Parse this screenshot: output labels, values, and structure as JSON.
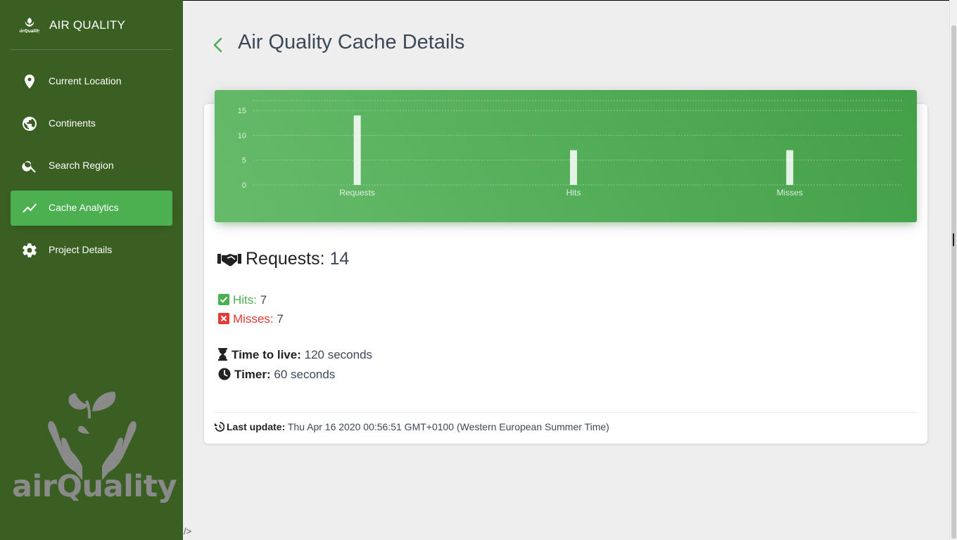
{
  "app": {
    "brand": "AIR QUALITY",
    "logo_text": "airQuality",
    "logo_small_text": "airQuality"
  },
  "nav": {
    "items": [
      {
        "label": "Current Location",
        "icon": "location-pin-icon"
      },
      {
        "label": "Continents",
        "icon": "globe-icon"
      },
      {
        "label": "Search Region",
        "icon": "search-icon"
      },
      {
        "label": "Cache Analytics",
        "icon": "trending-icon",
        "active": true
      },
      {
        "label": "Project Details",
        "icon": "gear-icon"
      }
    ]
  },
  "page": {
    "title": "Air Quality Cache Details",
    "stray_text": "/>"
  },
  "chart_data": {
    "type": "bar",
    "categories": [
      "Requests",
      "Hits",
      "Misses"
    ],
    "values": [
      14,
      7,
      7
    ],
    "yticks": [
      0,
      5,
      10,
      15
    ],
    "ylim": [
      0,
      17
    ],
    "title": "",
    "xlabel": "",
    "ylabel": "",
    "grid": true
  },
  "stats": {
    "requests_label": "Requests:",
    "requests_value": "14",
    "hits_label": "Hits:",
    "hits_value": "7",
    "misses_label": "Misses:",
    "misses_value": "7",
    "ttl_label": "Time to live:",
    "ttl_value": "120 seconds",
    "timer_label": "Timer:",
    "timer_value": "60 seconds"
  },
  "footer": {
    "last_update_label": "Last update:",
    "last_update_value": "Thu Apr 16 2020 00:56:51 GMT+0100 (Western European Summer Time)"
  },
  "colors": {
    "sidebar": "#3a5f22",
    "active": "#4caf50",
    "hits": "#4caf50",
    "misses": "#e53935"
  }
}
